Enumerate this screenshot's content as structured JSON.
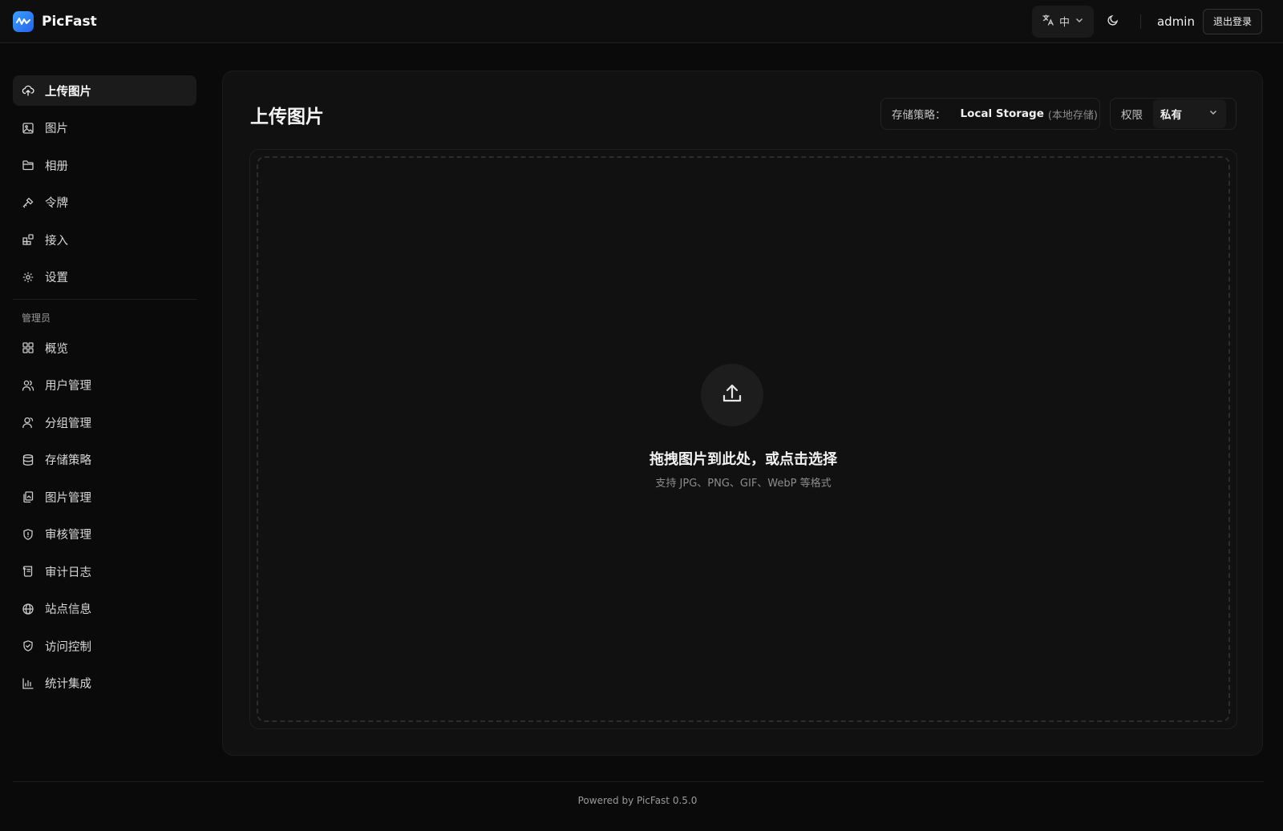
{
  "header": {
    "app_name": "PicFast",
    "lang": "中",
    "username": "admin",
    "logout_label": "退出登录"
  },
  "sidebar": {
    "items": [
      {
        "label": "上传图片",
        "icon": "cloud-upload-icon",
        "active": true
      },
      {
        "label": "图片",
        "icon": "image-icon"
      },
      {
        "label": "相册",
        "icon": "folder-icon"
      },
      {
        "label": "令牌",
        "icon": "key-icon"
      },
      {
        "label": "接入",
        "icon": "blocks-icon"
      },
      {
        "label": "设置",
        "icon": "gear-icon"
      }
    ],
    "admin_label": "管理员",
    "admin_items": [
      {
        "label": "概览",
        "icon": "grid-icon"
      },
      {
        "label": "用户管理",
        "icon": "users-icon"
      },
      {
        "label": "分组管理",
        "icon": "group-icon"
      },
      {
        "label": "存储策略",
        "icon": "database-icon"
      },
      {
        "label": "图片管理",
        "icon": "copy-icon"
      },
      {
        "label": "审核管理",
        "icon": "shield-alert-icon"
      },
      {
        "label": "审计日志",
        "icon": "scroll-icon"
      },
      {
        "label": "站点信息",
        "icon": "globe-icon"
      },
      {
        "label": "访问控制",
        "icon": "shield-check-icon"
      },
      {
        "label": "统计集成",
        "icon": "bar-chart-icon"
      }
    ]
  },
  "main": {
    "title": "上传图片",
    "policy_label": "存储策略：",
    "policy_value": "Local Storage",
    "policy_sub": "(本地存储)",
    "permission_label": "权限",
    "permission_value": "私有",
    "drop_title": "拖拽图片到此处，或点击选择",
    "drop_hint": "支持 JPG、PNG、GIF、WebP 等格式"
  },
  "footer": {
    "text": "Powered by PicFast 0.5.0"
  }
}
